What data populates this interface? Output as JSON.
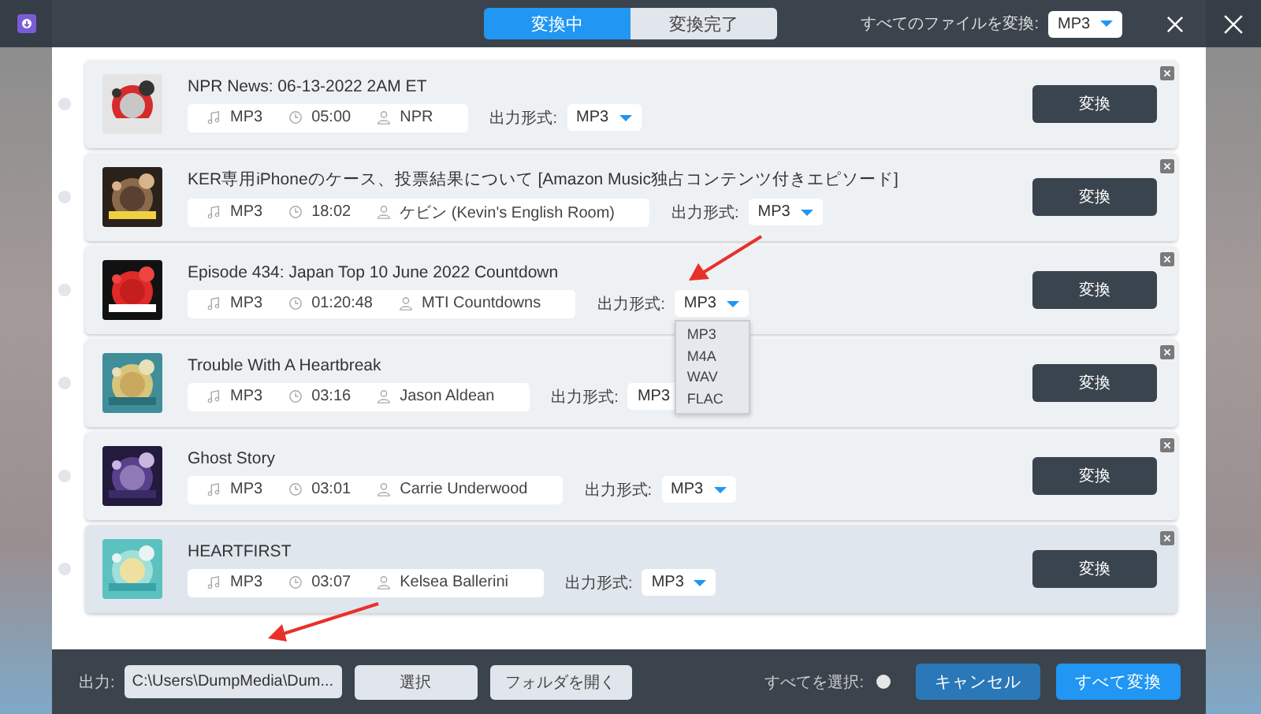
{
  "header": {
    "tabs": [
      {
        "label": "変換中",
        "selected": true
      },
      {
        "label": "変換完了",
        "selected": false
      }
    ],
    "convert_all_format": {
      "label": "すべてのファイルを変換:",
      "value": "MP3"
    }
  },
  "items": [
    {
      "title": "NPR News: 06-13-2022 2AM ET",
      "format": "MP3",
      "duration": "05:00",
      "artist": "NPR",
      "output_label": "出力形式:",
      "output_format": "MP3",
      "checked": false,
      "convert_button": "変換",
      "highlighted": false
    },
    {
      "title": "KER専用iPhoneのケース、投票結果について [Amazon Music独占コンテンツ付きエピソード]",
      "format": "MP3",
      "duration": "18:02",
      "artist": "ケビン (Kevin's English Room)",
      "output_label": "出力形式:",
      "output_format": "MP3",
      "checked": false,
      "convert_button": "変換",
      "highlighted": false
    },
    {
      "title": "Episode 434: Japan Top 10 June 2022 Countdown",
      "format": "MP3",
      "duration": "01:20:48",
      "artist": "MTI Countdowns",
      "output_label": "出力形式:",
      "output_format": "MP3",
      "checked": false,
      "options": [
        "MP3",
        "M4A",
        "WAV",
        "FLAC"
      ],
      "convert_button": "変換",
      "highlighted": false
    },
    {
      "title": "Trouble With A Heartbreak",
      "format": "MP3",
      "duration": "03:16",
      "artist": "Jason Aldean",
      "output_label": "出力形式:",
      "output_format": "MP3",
      "checked": false,
      "convert_button": "変換",
      "highlighted": false
    },
    {
      "title": "Ghost Story",
      "format": "MP3",
      "duration": "03:01",
      "artist": "Carrie Underwood",
      "output_label": "出力形式:",
      "output_format": "MP3",
      "checked": false,
      "convert_button": "変換",
      "highlighted": false
    },
    {
      "title": "HEARTFIRST",
      "format": "MP3",
      "duration": "03:07",
      "artist": "Kelsea Ballerini",
      "output_label": "出力形式:",
      "output_format": "MP3",
      "checked": false,
      "convert_button": "変換",
      "highlighted": true
    }
  ],
  "footer": {
    "output_label": "出力:",
    "path": "C:\\Users\\DumpMedia\\Dum...",
    "choose_button": "選択",
    "open_folder_button": "フォルダを開く",
    "select_all": {
      "label": "すべてを選択:",
      "checked": false
    },
    "cancel_button": "キャンセル",
    "convert_all_button": "すべて変換"
  }
}
